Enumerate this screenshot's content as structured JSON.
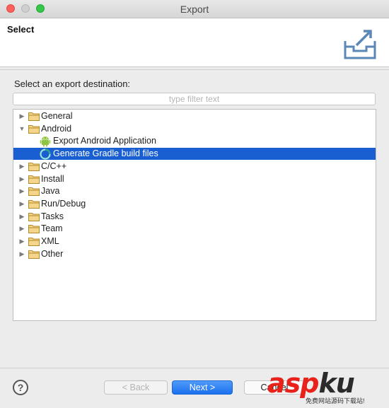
{
  "window": {
    "title": "Export"
  },
  "header": {
    "title": "Select",
    "icon": "export-icon"
  },
  "prompt": "Select an export destination:",
  "filter": {
    "placeholder": "type filter text",
    "value": ""
  },
  "tree": {
    "items": [
      {
        "label": "General",
        "expanded": false,
        "level": 0,
        "icon": "folder-icon"
      },
      {
        "label": "Android",
        "expanded": true,
        "level": 0,
        "icon": "folder-icon"
      },
      {
        "label": "Export Android Application",
        "level": 1,
        "icon": "android-icon"
      },
      {
        "label": "Generate Gradle build files",
        "level": 1,
        "icon": "gradle-icon",
        "selected": true
      },
      {
        "label": "C/C++",
        "expanded": false,
        "level": 0,
        "icon": "folder-icon"
      },
      {
        "label": "Install",
        "expanded": false,
        "level": 0,
        "icon": "folder-icon"
      },
      {
        "label": "Java",
        "expanded": false,
        "level": 0,
        "icon": "folder-icon"
      },
      {
        "label": "Run/Debug",
        "expanded": false,
        "level": 0,
        "icon": "folder-icon"
      },
      {
        "label": "Tasks",
        "expanded": false,
        "level": 0,
        "icon": "folder-icon"
      },
      {
        "label": "Team",
        "expanded": false,
        "level": 0,
        "icon": "folder-icon"
      },
      {
        "label": "XML",
        "expanded": false,
        "level": 0,
        "icon": "folder-icon"
      },
      {
        "label": "Other",
        "expanded": false,
        "level": 0,
        "icon": "folder-icon"
      }
    ]
  },
  "footer": {
    "help": "?",
    "back_label": "< Back",
    "next_label": "Next >",
    "cancel_label": "Cancel"
  },
  "watermark": {
    "main": "aspku",
    "sub": "免费网站源码下载站!",
    "color_red": "#e8211b",
    "color_dark": "#2b2b2b"
  },
  "colors": {
    "selection": "#1a5fd1",
    "primary_button": "#1c70ef"
  }
}
